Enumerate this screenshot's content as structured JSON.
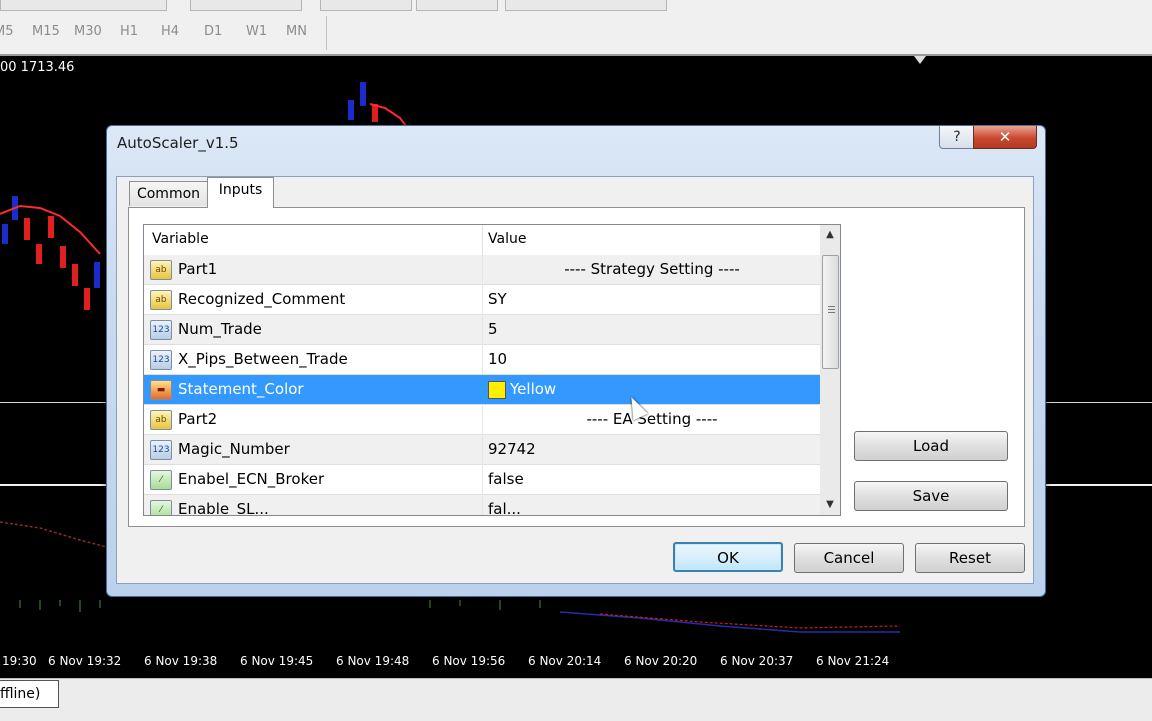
{
  "timeframes": [
    "M5",
    "M15",
    "M30",
    "H1",
    "H4",
    "D1",
    "W1",
    "MN"
  ],
  "chart": {
    "price_label": "00 1713.46",
    "time_labels": [
      "19:30",
      "6 Nov 19:32",
      "6 Nov 19:38",
      "6 Nov 19:45",
      "6 Nov 19:48",
      "6 Nov 19:56",
      "6 Nov 20:14",
      "6 Nov 20:20",
      "6 Nov 20:37",
      "6 Nov 21:24"
    ],
    "colors": {
      "bull": "#1b2ccc",
      "bear": "#e02020",
      "ma": "#ff2a2a"
    }
  },
  "status": {
    "tab": "ffline)"
  },
  "dialog": {
    "title": "AutoScaler_v1.5",
    "help_label": "?",
    "close_label": "✕",
    "tabs": [
      {
        "label": "Common",
        "active": false
      },
      {
        "label": "Inputs",
        "active": true
      }
    ],
    "columns": {
      "variable": "Variable",
      "value": "Value"
    },
    "rows": [
      {
        "icon": "ab",
        "name": "Part1",
        "value": "---- Strategy Setting ----",
        "centered": true
      },
      {
        "icon": "ab",
        "name": "Recognized_Comment",
        "value": "SY"
      },
      {
        "icon": "num",
        "name": "Num_Trade",
        "value": "5"
      },
      {
        "icon": "num",
        "name": "X_Pips_Between_Trade",
        "value": "10"
      },
      {
        "icon": "color",
        "name": "Statement_Color",
        "value": "Yellow",
        "selected": true,
        "swatch": "#ffee00"
      },
      {
        "icon": "ab",
        "name": "Part2",
        "value": "---- EA Setting ----",
        "centered": true
      },
      {
        "icon": "num",
        "name": "Magic_Number",
        "value": "92742"
      },
      {
        "icon": "bool",
        "name": "Enabel_ECN_Broker",
        "value": "false"
      },
      {
        "icon": "bool",
        "name": "Enable_SL...",
        "value": "fal..."
      }
    ],
    "icon_text": {
      "ab": "ab",
      "num": "123",
      "color": "▬",
      "bool": "⁄"
    },
    "buttons": {
      "load": "Load",
      "save": "Save",
      "ok": "OK",
      "cancel": "Cancel",
      "reset": "Reset"
    }
  }
}
